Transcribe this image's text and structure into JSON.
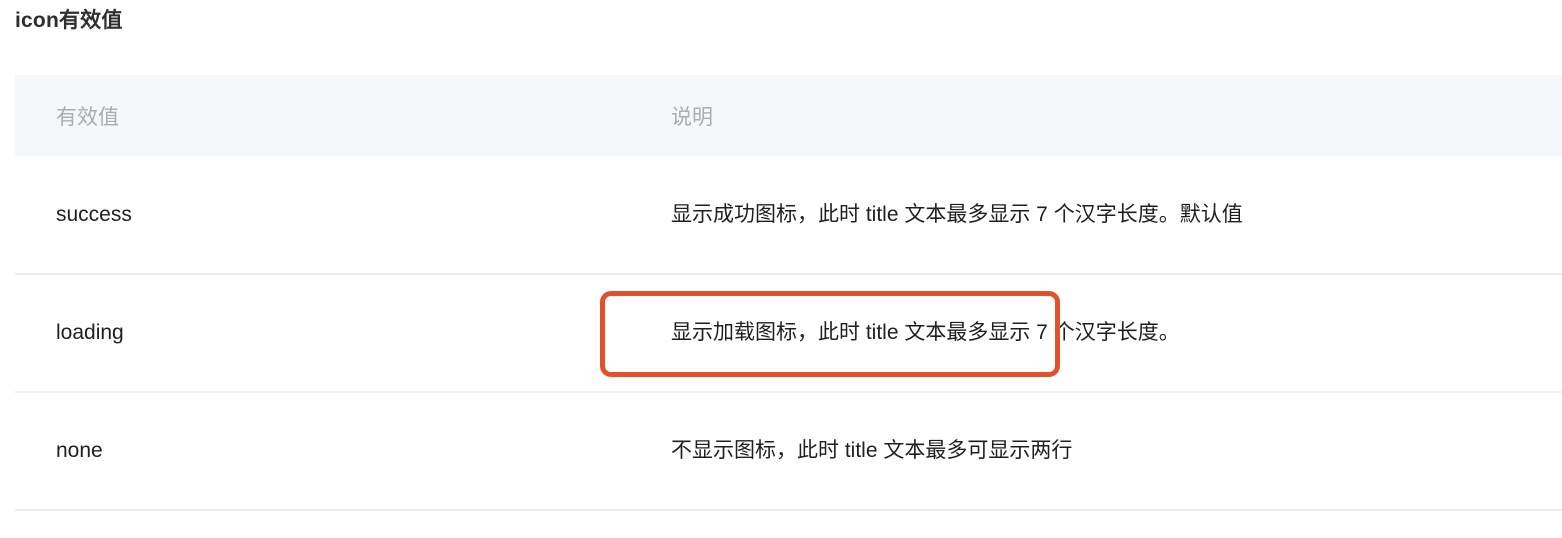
{
  "page": {
    "title": "icon有效值",
    "background_color": "#ffffff"
  },
  "table": {
    "header_background": "#f6f7f9",
    "header_text_color": "#a9acb3",
    "divider_color": "#edeef0",
    "columns": [
      {
        "key": "value",
        "label": "有效值"
      },
      {
        "key": "desc",
        "label": "说明"
      }
    ],
    "rows": [
      {
        "value": "success",
        "desc": "显示成功图标，此时 title 文本最多显示 7 个汉字长度。默认值"
      },
      {
        "value": "loading",
        "desc": "显示加载图标，此时 title 文本最多显示 7 个汉字长度。"
      },
      {
        "value": "none",
        "desc": "不显示图标，此时 title 文本最多可显示两行"
      }
    ]
  },
  "annotation": {
    "highlight_color": "#e2522a",
    "label": "title 文本最多显示 7 个汉字长度。",
    "target_row_value": "loading"
  }
}
